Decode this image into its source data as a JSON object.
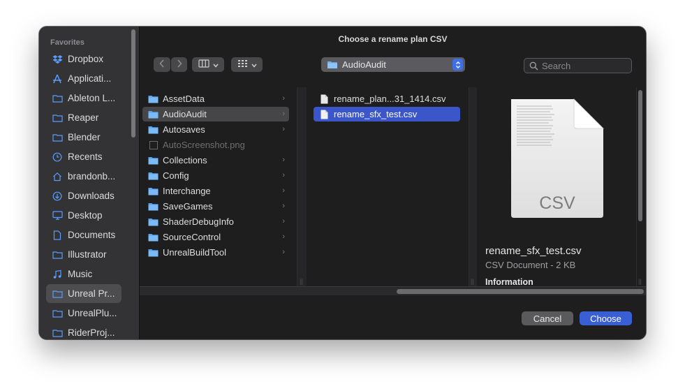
{
  "dialog": {
    "title": "Choose a rename plan CSV"
  },
  "sidebar": {
    "heading": "Favorites",
    "items": [
      {
        "label": "Dropbox",
        "icon": "dropbox-icon"
      },
      {
        "label": "Applicati...",
        "icon": "applications-icon"
      },
      {
        "label": "Ableton L...",
        "icon": "folder-icon"
      },
      {
        "label": "Reaper",
        "icon": "folder-icon"
      },
      {
        "label": "Blender",
        "icon": "folder-icon"
      },
      {
        "label": "Recents",
        "icon": "clock-icon"
      },
      {
        "label": "brandonb...",
        "icon": "home-icon"
      },
      {
        "label": "Downloads",
        "icon": "download-icon"
      },
      {
        "label": "Desktop",
        "icon": "desktop-icon"
      },
      {
        "label": "Documents",
        "icon": "document-icon"
      },
      {
        "label": "Illustrator",
        "icon": "folder-icon"
      },
      {
        "label": "Music",
        "icon": "music-icon"
      },
      {
        "label": "Unreal Pr...",
        "icon": "folder-icon"
      },
      {
        "label": "UnrealPlu...",
        "icon": "folder-icon"
      },
      {
        "label": "RiderProj...",
        "icon": "folder-icon"
      }
    ]
  },
  "toolbar": {
    "location": "AudioAudit",
    "search_placeholder": "Search"
  },
  "column1": {
    "items": [
      {
        "label": "AssetData"
      },
      {
        "label": "AudioAudit"
      },
      {
        "label": "Autosaves"
      },
      {
        "label": "AutoScreenshot.png"
      },
      {
        "label": "Collections"
      },
      {
        "label": "Config"
      },
      {
        "label": "Interchange"
      },
      {
        "label": "SaveGames"
      },
      {
        "label": "ShaderDebugInfo"
      },
      {
        "label": "SourceControl"
      },
      {
        "label": "UnrealBuildTool"
      }
    ]
  },
  "column2": {
    "items": [
      {
        "label": "rename_plan...31_1414.csv"
      },
      {
        "label": "rename_sfx_test.csv"
      }
    ]
  },
  "preview": {
    "doc_label": "CSV",
    "name": "rename_sfx_test.csv",
    "kind": "CSV Document - 2 KB",
    "info_heading": "Information"
  },
  "buttons": {
    "cancel": "Cancel",
    "choose": "Choose"
  },
  "colors": {
    "accent": "#3a56c9",
    "window_bg": "#1e1e1e",
    "sidebar_bg": "#333336"
  }
}
